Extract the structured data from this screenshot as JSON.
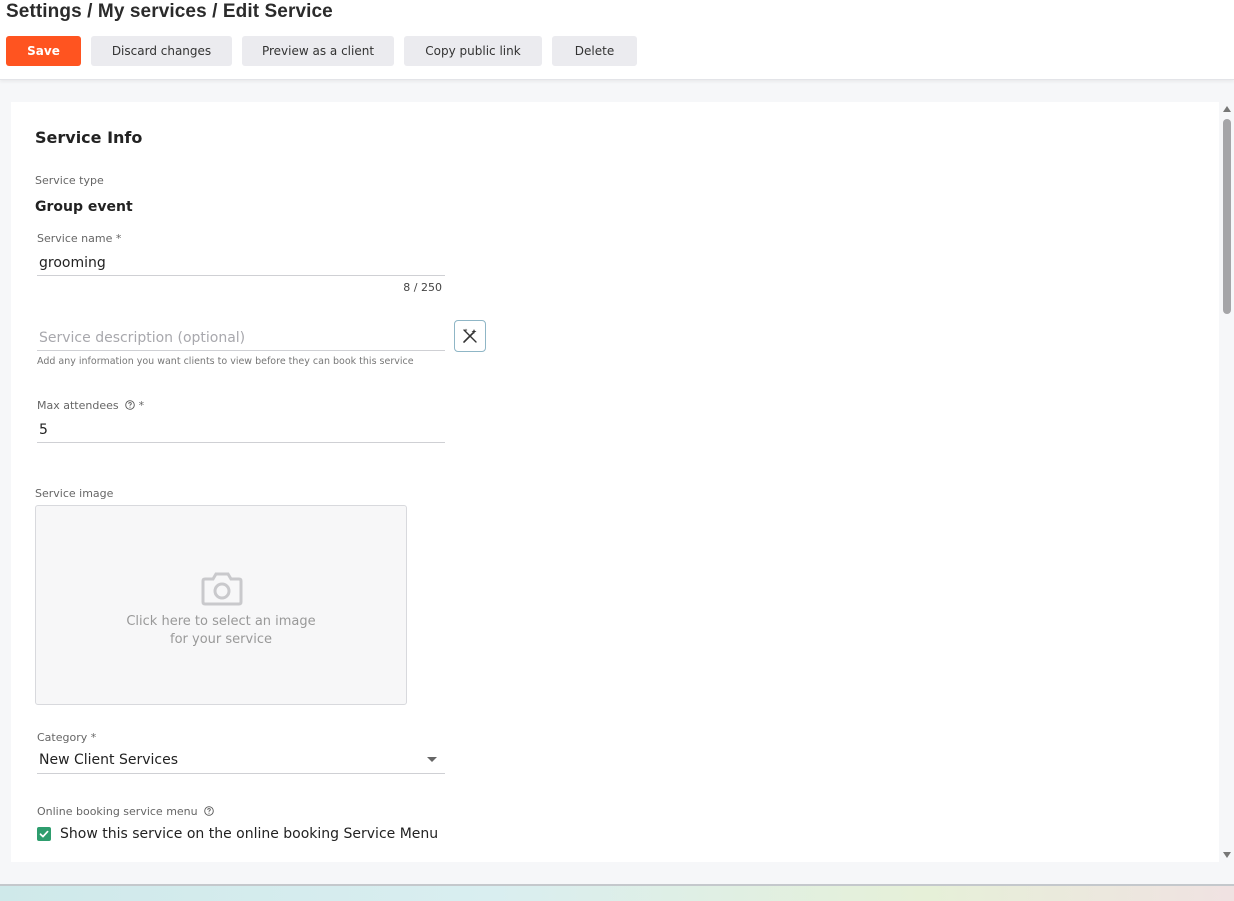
{
  "header": {
    "breadcrumb": "Settings / My services / Edit Service"
  },
  "toolbar": {
    "save_label": "Save",
    "discard_label": "Discard changes",
    "preview_label": "Preview as a client",
    "copy_link_label": "Copy public link",
    "delete_label": "Delete",
    "save_color": "#ff5420"
  },
  "service_info": {
    "title": "Service Info",
    "service_type_label": "Service type",
    "service_type_value": "Group event",
    "service_name_label": "Service name *",
    "service_name_value": "grooming",
    "service_name_counter": "8 / 250",
    "description_placeholder": "Service description (optional)",
    "description_help": "Add any information you want clients to view before they can book this service",
    "max_attendees_label": "Max attendees",
    "max_attendees_required": "*",
    "max_attendees_value": "5",
    "service_image_label": "Service image",
    "image_caption_line1": "Click here to select an image",
    "image_caption_line2": "for your service",
    "category_label": "Category *",
    "category_value": "New Client Services",
    "online_menu_label": "Online booking service menu",
    "online_menu_checkbox_label": "Show this service on the online booking Service Menu",
    "online_menu_checked": true,
    "checkbox_color": "#2e9d6e"
  },
  "icons": {
    "ai_button": "magic-wand-icon",
    "help": "help-circle-icon",
    "image": "camera-icon",
    "dropdown": "caret-down-icon",
    "check": "check-icon"
  }
}
